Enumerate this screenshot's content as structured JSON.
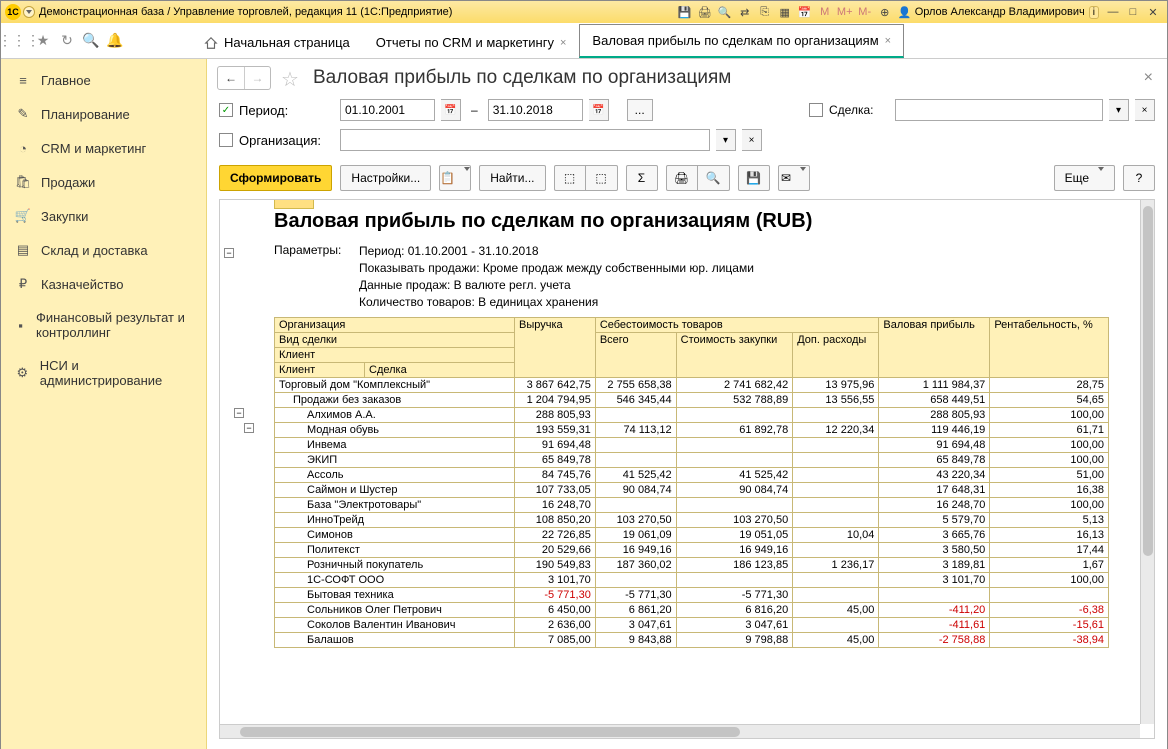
{
  "title_bar": {
    "app_logo_text": "1C",
    "title": "Демонстрационная база / Управление торговлей, редакция 11  (1С:Предприятие)",
    "m_btns": [
      "M",
      "M+",
      "M-"
    ],
    "user_name": "Орлов Александр Владимирович",
    "info_badge": "i"
  },
  "tabs": {
    "home": "Начальная страница",
    "items": [
      {
        "label": "Отчеты по CRM и маркетингу",
        "active": false
      },
      {
        "label": "Валовая прибыль по сделкам по организациям",
        "active": true
      }
    ]
  },
  "sidebar": {
    "items": [
      {
        "label": "Главное"
      },
      {
        "label": "Планирование"
      },
      {
        "label": "CRM и маркетинг"
      },
      {
        "label": "Продажи"
      },
      {
        "label": "Закупки"
      },
      {
        "label": "Склад и доставка"
      },
      {
        "label": "Казначейство"
      },
      {
        "label": "Финансовый результат и контроллинг"
      },
      {
        "label": "НСИ и администрирование"
      }
    ]
  },
  "page": {
    "title": "Валовая прибыль по сделкам по организациям",
    "close": "×"
  },
  "filters": {
    "period_label": "Период:",
    "period_from": "01.10.2001",
    "period_dash": "–",
    "period_to": "31.10.2018",
    "dots": "...",
    "deal_label": "Сделка:",
    "org_label": "Организация:",
    "clear": "×"
  },
  "toolbar": {
    "form": "Сформировать",
    "settings": "Настройки...",
    "find": "Найти...",
    "more": "Еще",
    "help": "?"
  },
  "report": {
    "title": "Валовая прибыль по сделкам по организациям (RUB)",
    "params_label": "Параметры:",
    "params": [
      "Период: 01.10.2001 - 31.10.2018",
      "Показывать продажи: Кроме продаж между собственными юр. лицами",
      "Данные продаж: В валюте регл. учета",
      "Количество товаров: В единицах хранения"
    ],
    "headers": {
      "org": "Организация",
      "deal_type": "Вид сделки",
      "client": "Клиент",
      "client2": "Клиент",
      "deal": "Сделка",
      "revenue": "Выручка",
      "cost_goods": "Себестоимость товаров",
      "cost_total": "Всего",
      "cost_purchase": "Стоимость закупки",
      "cost_extra": "Доп. расходы",
      "gross_profit": "Валовая прибыль",
      "profitability": "Рентабельность, %"
    },
    "rows": [
      {
        "lvl": 0,
        "name": "Торговый дом \"Комплексный\"",
        "rev": "3 867 642,75",
        "ct": "2 755 658,38",
        "cp": "2 741 682,42",
        "ce": "13 975,96",
        "gp": "1 111 984,37",
        "pr": "28,75"
      },
      {
        "lvl": 1,
        "name": "Продажи без заказов",
        "rev": "1 204 794,95",
        "ct": "546 345,44",
        "cp": "532 788,89",
        "ce": "13 556,55",
        "gp": "658 449,51",
        "pr": "54,65"
      },
      {
        "lvl": 2,
        "name": "Алхимов А.А.",
        "rev": "288 805,93",
        "ct": "",
        "cp": "",
        "ce": "",
        "gp": "288 805,93",
        "pr": "100,00"
      },
      {
        "lvl": 2,
        "name": "Модная обувь",
        "rev": "193 559,31",
        "ct": "74 113,12",
        "cp": "61 892,78",
        "ce": "12 220,34",
        "gp": "119 446,19",
        "pr": "61,71"
      },
      {
        "lvl": 2,
        "name": "Инвема",
        "rev": "91 694,48",
        "ct": "",
        "cp": "",
        "ce": "",
        "gp": "91 694,48",
        "pr": "100,00"
      },
      {
        "lvl": 2,
        "name": "ЭКИП",
        "rev": "65 849,78",
        "ct": "",
        "cp": "",
        "ce": "",
        "gp": "65 849,78",
        "pr": "100,00"
      },
      {
        "lvl": 2,
        "name": "Ассоль",
        "rev": "84 745,76",
        "ct": "41 525,42",
        "cp": "41 525,42",
        "ce": "",
        "gp": "43 220,34",
        "pr": "51,00"
      },
      {
        "lvl": 2,
        "name": "Саймон и Шустер",
        "rev": "107 733,05",
        "ct": "90 084,74",
        "cp": "90 084,74",
        "ce": "",
        "gp": "17 648,31",
        "pr": "16,38"
      },
      {
        "lvl": 2,
        "name": "База \"Электротовары\"",
        "rev": "16 248,70",
        "ct": "",
        "cp": "",
        "ce": "",
        "gp": "16 248,70",
        "pr": "100,00"
      },
      {
        "lvl": 2,
        "name": "ИнноТрейд",
        "rev": "108 850,20",
        "ct": "103 270,50",
        "cp": "103 270,50",
        "ce": "",
        "gp": "5 579,70",
        "pr": "5,13"
      },
      {
        "lvl": 2,
        "name": "Симонов",
        "rev": "22 726,85",
        "ct": "19 061,09",
        "cp": "19 051,05",
        "ce": "10,04",
        "gp": "3 665,76",
        "pr": "16,13"
      },
      {
        "lvl": 2,
        "name": "Политекст",
        "rev": "20 529,66",
        "ct": "16 949,16",
        "cp": "16 949,16",
        "ce": "",
        "gp": "3 580,50",
        "pr": "17,44"
      },
      {
        "lvl": 2,
        "name": "Розничный покупатель",
        "rev": "190 549,83",
        "ct": "187 360,02",
        "cp": "186 123,85",
        "ce": "1 236,17",
        "gp": "3 189,81",
        "pr": "1,67"
      },
      {
        "lvl": 2,
        "name": "1С-СОФТ ООО",
        "rev": "3 101,70",
        "ct": "",
        "cp": "",
        "ce": "",
        "gp": "3 101,70",
        "pr": "100,00"
      },
      {
        "lvl": 2,
        "name": "Бытовая техника",
        "rev": "-5 771,30",
        "ct": "-5 771,30",
        "cp": "-5 771,30",
        "ce": "",
        "gp": "",
        "pr": "",
        "neg_rev": true,
        "neg_ct": false
      },
      {
        "lvl": 2,
        "name": "Сольников Олег Петрович",
        "rev": "6 450,00",
        "ct": "6 861,20",
        "cp": "6 816,20",
        "ce": "45,00",
        "gp": "-411,20",
        "pr": "-6,38",
        "neg_gp": true,
        "neg_pr": true
      },
      {
        "lvl": 2,
        "name": "Соколов Валентин Иванович",
        "rev": "2 636,00",
        "ct": "3 047,61",
        "cp": "3 047,61",
        "ce": "",
        "gp": "-411,61",
        "pr": "-15,61",
        "neg_gp": true,
        "neg_pr": true
      },
      {
        "lvl": 2,
        "name": "Балашов",
        "rev": "7 085,00",
        "ct": "9 843,88",
        "cp": "9 798,88",
        "ce": "45,00",
        "gp": "-2 758,88",
        "pr": "-38,94",
        "neg_gp": true,
        "neg_pr": true
      }
    ]
  }
}
